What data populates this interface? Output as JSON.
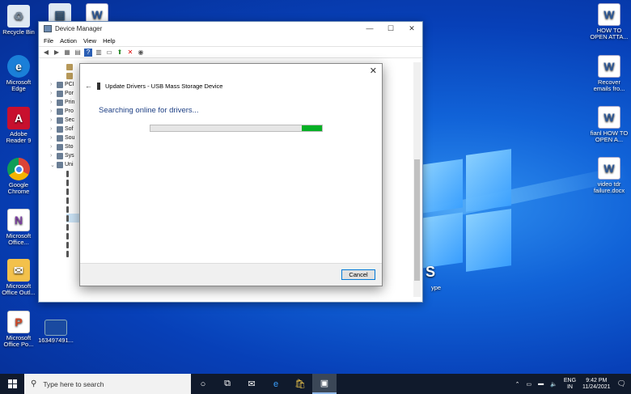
{
  "desktop": {
    "left_icons": [
      {
        "label": "Recycle Bin",
        "icon": "recycle-bin-icon"
      },
      {
        "label": "Microsoft Edge",
        "icon": "edge-icon"
      },
      {
        "label": "Adobe Reader 9",
        "icon": "adobe-reader-icon"
      },
      {
        "label": "Google Chrome",
        "icon": "chrome-icon"
      },
      {
        "label": "Microsoft Office...",
        "icon": "office-icon"
      },
      {
        "label": "Microsoft Office Outl...",
        "icon": "outlook-icon"
      },
      {
        "label": "Microsoft Office Po...",
        "icon": "powerpoint-icon"
      }
    ],
    "misc_icon_label": "163497491...",
    "right_icons": [
      {
        "label": "HOW TO OPEN ATTA..."
      },
      {
        "label": "Recover emails fro..."
      },
      {
        "label": "fianl HOW TO OPEN A..."
      },
      {
        "label": "video tdr failure.docx"
      }
    ],
    "partial_label": "ype"
  },
  "device_manager": {
    "title": "Device Manager",
    "menu": [
      "File",
      "Action",
      "View",
      "Help"
    ],
    "tree": [
      "PCI",
      "Por",
      "Prin",
      "Pro",
      "Sec",
      "Sof",
      "Sou",
      "Sto",
      "Sys",
      "Uni"
    ]
  },
  "dialog": {
    "header": "Update Drivers - USB Mass Storage Device",
    "status": "Searching online for drivers...",
    "progress_fraction": 0.88,
    "cancel_label": "Cancel"
  },
  "taskbar": {
    "search_placeholder": "Type here to search",
    "lang_top": "ENG",
    "lang_bottom": "IN",
    "time": "9:42 PM",
    "date": "11/24/2021"
  },
  "colors": {
    "accent": "#0078d7",
    "progress": "#06b025",
    "taskbar": "#101a2c"
  }
}
